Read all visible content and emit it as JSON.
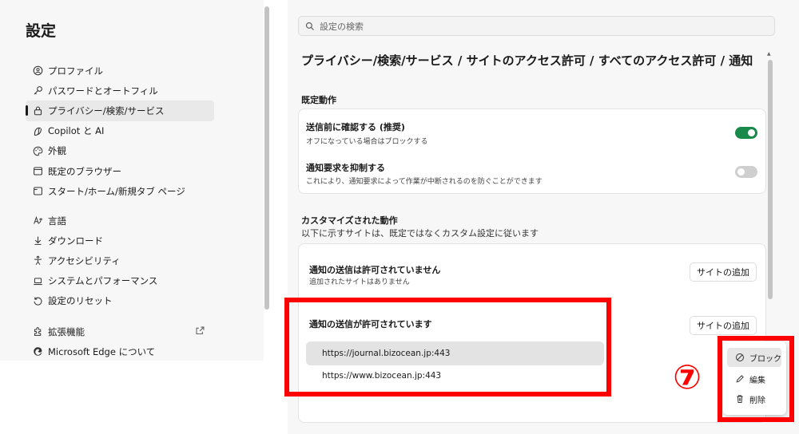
{
  "sidebar": {
    "title": "設定",
    "groups": [
      [
        {
          "label": "プロファイル",
          "icon": "profile-icon"
        },
        {
          "label": "パスワードとオートフィル",
          "icon": "key-icon"
        },
        {
          "label": "プライバシー/検索/サービス",
          "icon": "lock-icon",
          "active": true
        },
        {
          "label": "Copilot と AI",
          "icon": "copilot-icon"
        },
        {
          "label": "外観",
          "icon": "palette-icon"
        },
        {
          "label": "既定のブラウザー",
          "icon": "browser-icon"
        },
        {
          "label": "スタート/ホーム/新規タブ ページ",
          "icon": "home-page-icon"
        }
      ],
      [
        {
          "label": "言語",
          "icon": "language-icon"
        },
        {
          "label": "ダウンロード",
          "icon": "download-icon"
        },
        {
          "label": "アクセシビリティ",
          "icon": "accessibility-icon"
        },
        {
          "label": "システムとパフォーマンス",
          "icon": "laptop-icon"
        },
        {
          "label": "設定のリセット",
          "icon": "reset-icon"
        }
      ],
      [
        {
          "label": "拡張機能",
          "icon": "puzzle-icon"
        },
        {
          "label": "Microsoft Edge について",
          "icon": "edge-icon"
        }
      ]
    ]
  },
  "search": {
    "placeholder": "設定の検索"
  },
  "breadcrumb": "プライバシー/検索/サービス / サイトのアクセス許可 / すべてのアクセス許可 / 通知",
  "default_behavior": {
    "heading": "既定動作",
    "rows": [
      {
        "title": "送信前に確認する (推奨)",
        "desc": "オフになっている場合はブロックする",
        "enabled": true
      },
      {
        "title": "通知要求を抑制する",
        "desc": "これにより、通知要求によって作業が中断されるのを防ぐことができます",
        "enabled": false
      }
    ]
  },
  "custom_behavior": {
    "heading": "カスタマイズされた動作",
    "subtitle": "以下に示すサイトは、既定ではなくカスタム設定に従います",
    "blocked": {
      "title": "通知の送信は許可されていません",
      "empty_text": "追加されたサイトはありません",
      "add_label": "サイトの追加"
    },
    "allowed": {
      "title": "通知の送信が許可されています",
      "add_label": "サイトの追加",
      "sites": [
        "https://journal.bizocean.jp:443",
        "https://www.bizocean.jp:443"
      ]
    }
  },
  "context_menu": {
    "items": [
      {
        "label": "ブロック",
        "icon": "block-icon"
      },
      {
        "label": "編集",
        "icon": "pencil-icon"
      },
      {
        "label": "削除",
        "icon": "trash-icon"
      }
    ]
  },
  "annotation": {
    "label": "⑦"
  },
  "colors": {
    "toggle_on": "#1a8a4a",
    "highlight": "#ff0000"
  }
}
